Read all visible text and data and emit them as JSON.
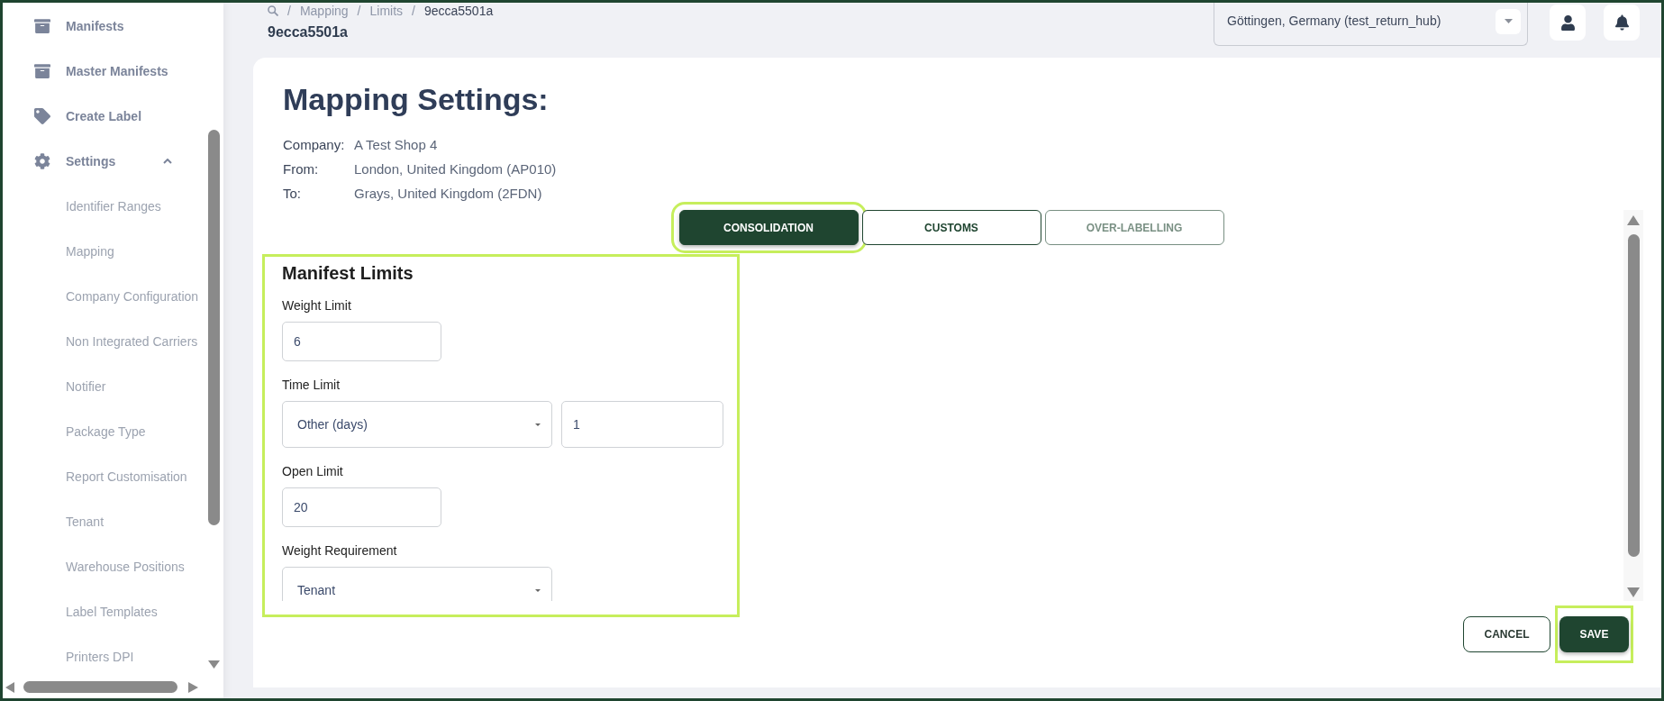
{
  "sidebar": {
    "items": [
      {
        "kind": "link",
        "label": "Manifests"
      },
      {
        "kind": "link",
        "label": "Master Manifests"
      },
      {
        "kind": "link",
        "label": "Create Label"
      },
      {
        "kind": "group",
        "label": "Settings",
        "expanded": true,
        "children": [
          {
            "label": "Identifier Ranges"
          },
          {
            "label": "Mapping"
          },
          {
            "label": "Company Configuration"
          },
          {
            "label": "Non Integrated Carriers"
          },
          {
            "label": "Notifier"
          },
          {
            "label": "Package Type"
          },
          {
            "label": "Report Customisation"
          },
          {
            "label": "Tenant"
          },
          {
            "label": "Warehouse Positions"
          },
          {
            "label": "Label Templates"
          },
          {
            "label": "Printers DPI"
          }
        ]
      }
    ]
  },
  "breadcrumb": {
    "items": [
      {
        "separator": "/",
        "label": "Mapping",
        "current": false
      },
      {
        "separator": "/",
        "label": "Limits",
        "current": false
      },
      {
        "separator": "/",
        "label": "9ecca5501a",
        "current": true
      }
    ]
  },
  "page_title": "9ecca5501a",
  "location_select": {
    "value": "Göttingen, Germany (test_return_hub)"
  },
  "card": {
    "title": "Mapping Settings:",
    "details": [
      {
        "label": "Company:",
        "value": "A Test Shop 4"
      },
      {
        "label": "From:",
        "value": "London, United Kingdom (AP010)"
      },
      {
        "label": "To:",
        "value": "Grays, United Kingdom (2FDN)"
      }
    ],
    "tabs": [
      {
        "label": "CONSOLIDATION",
        "selected": true,
        "disabled": false,
        "highlighted": true
      },
      {
        "label": "CUSTOMS",
        "selected": false,
        "disabled": false,
        "highlighted": false
      },
      {
        "label": "OVER-LABELLING",
        "selected": false,
        "disabled": true,
        "highlighted": false
      }
    ],
    "section": {
      "title": "Manifest Limits",
      "highlighted": true,
      "fields": [
        {
          "kind": "input",
          "label": "Weight Limit",
          "value": "6"
        },
        {
          "kind": "select_input",
          "label": "Time Limit",
          "value": "Other (days)",
          "input_value": "1"
        },
        {
          "kind": "input",
          "label": "Open Limit",
          "value": "20"
        },
        {
          "kind": "select",
          "label": "Weight Requirement",
          "value": "Tenant"
        }
      ]
    },
    "buttons": [
      {
        "kind": "cancel",
        "label": "CANCEL",
        "highlighted": false
      },
      {
        "kind": "save",
        "label": "SAVE",
        "highlighted": true
      }
    ]
  }
}
